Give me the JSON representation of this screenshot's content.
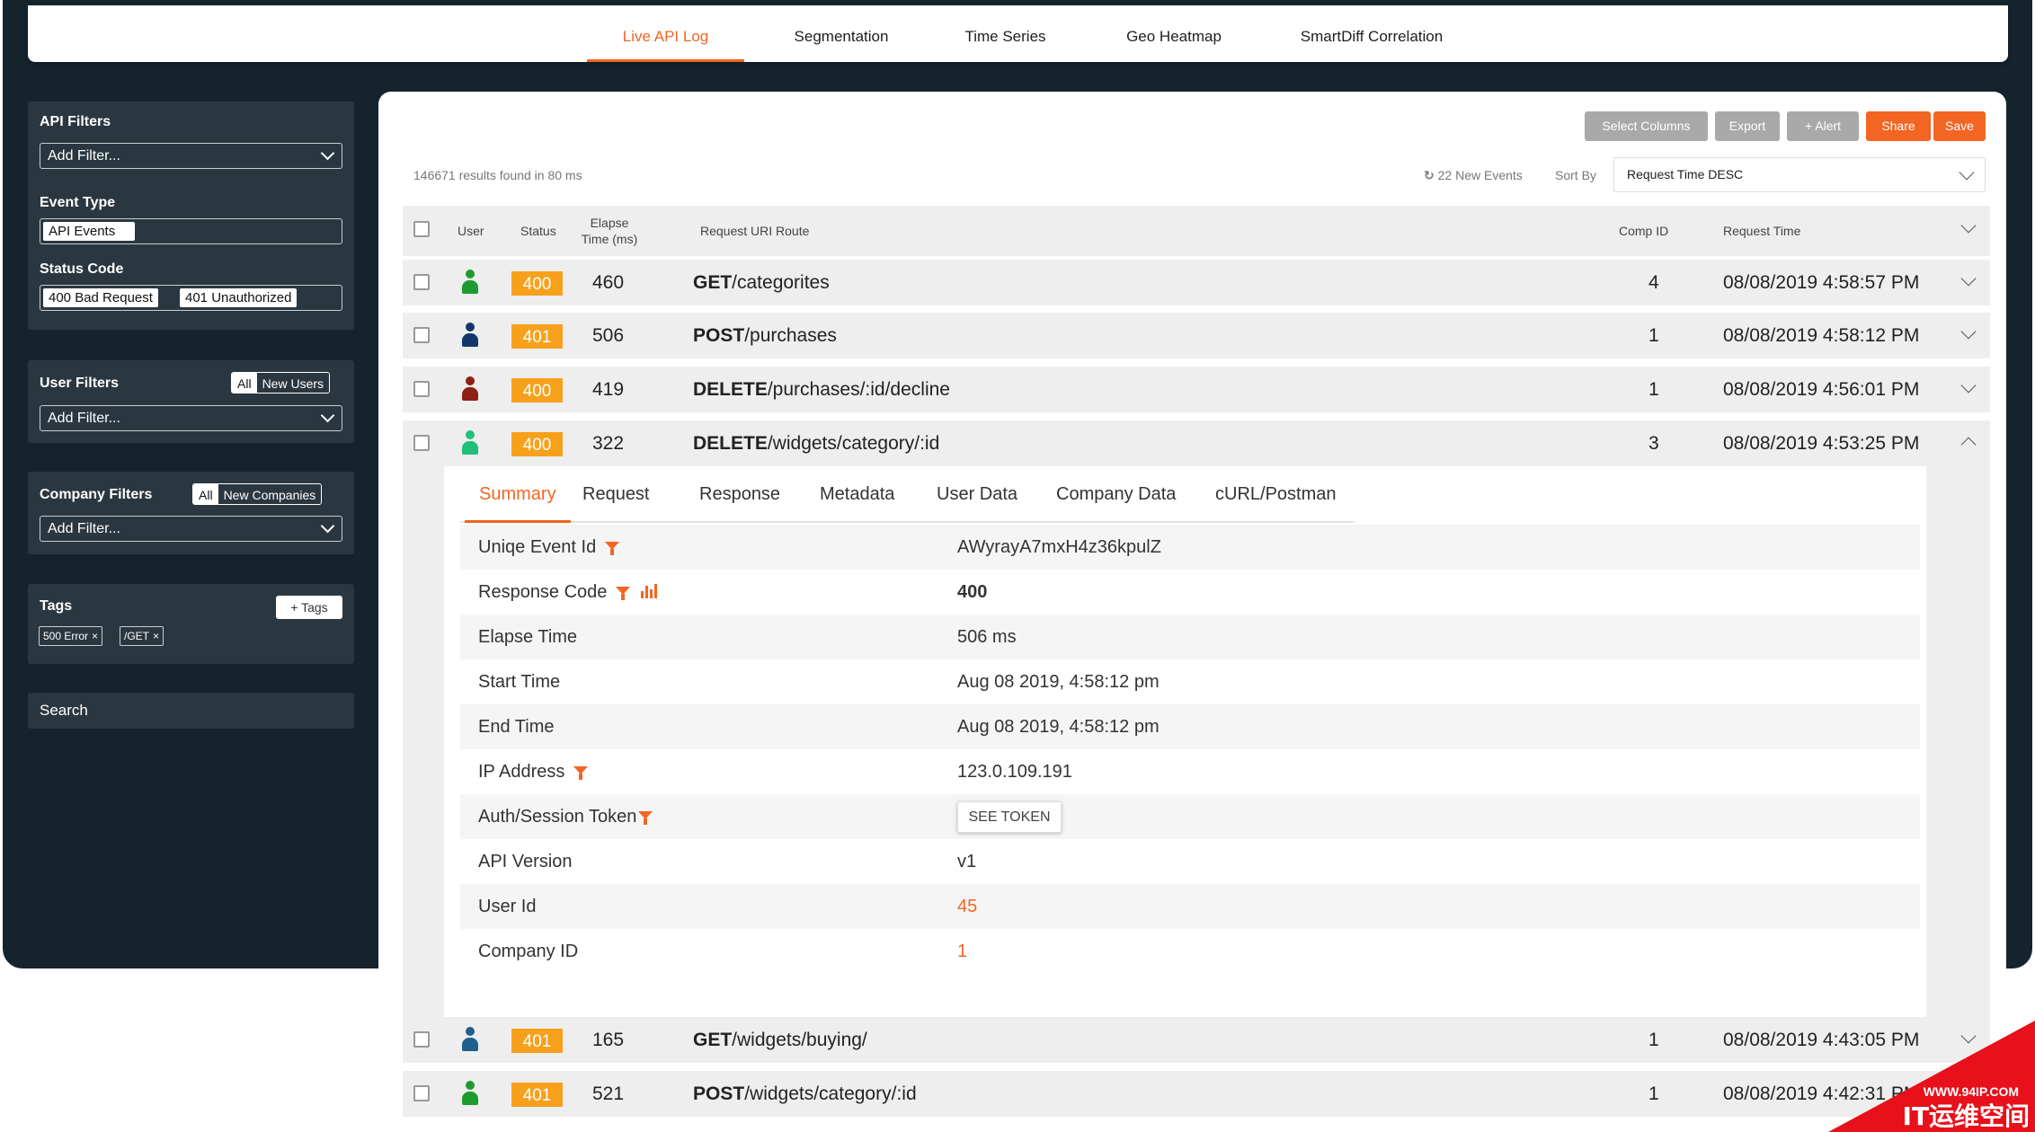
{
  "nav": {
    "tabs": [
      {
        "label": "Live API Log",
        "active": true
      },
      {
        "label": "Segmentation",
        "active": false
      },
      {
        "label": "Time Series",
        "active": false
      },
      {
        "label": "Geo Heatmap",
        "active": false
      },
      {
        "label": "SmartDiff Correlation",
        "active": false
      }
    ]
  },
  "sidebar": {
    "api_filters": {
      "title": "API Filters",
      "placeholder": "Add Filter..."
    },
    "event_type": {
      "title": "Event Type",
      "chips": [
        "API Events"
      ]
    },
    "status_code": {
      "title": "Status Code",
      "chips": [
        "400 Bad Request",
        "401 Unauthorized"
      ]
    },
    "user_filters": {
      "title": "User Filters",
      "toggle": [
        "All",
        "New Users"
      ],
      "placeholder": "Add Filter..."
    },
    "company_filters": {
      "title": "Company Filters",
      "toggle": [
        "All",
        "New Companies"
      ],
      "placeholder": "Add Filter..."
    },
    "tags": {
      "title": "Tags",
      "add_label": "+ Tags",
      "chips": [
        "500 Error",
        "/GET"
      ]
    },
    "search_label": "Search"
  },
  "toolbar": {
    "select_columns": "Select Columns",
    "export": "Export",
    "alert": "+ Alert",
    "share": "Share",
    "save": "Save"
  },
  "results": {
    "summary": "146671 results found in 80 ms",
    "new_events": "22 New Events",
    "sort_by_label": "Sort By",
    "sort_value": "Request Time DESC"
  },
  "table": {
    "headers": {
      "user": "User",
      "status": "Status",
      "elapse_1": "Elapse",
      "elapse_2": "Time (ms)",
      "route": "Request URI Route",
      "comp_id": "Comp ID",
      "request_time": "Request Time"
    },
    "rows": [
      {
        "user_color": "#1e9b2e",
        "status": "400",
        "elapse": "460",
        "method": "GET",
        "path": "/categorites",
        "comp_id": "4",
        "time": "08/08/2019 4:58:57 PM"
      },
      {
        "user_color": "#12386b",
        "status": "401",
        "elapse": "506",
        "method": "POST",
        "path": "/purchases",
        "comp_id": "1",
        "time": "08/08/2019 4:58:12 PM"
      },
      {
        "user_color": "#8b2212",
        "status": "400",
        "elapse": "419",
        "method": "DELETE",
        "path": "/purchases/:id/decline",
        "comp_id": "1",
        "time": "08/08/2019 4:56:01 PM"
      },
      {
        "user_color": "#1fc07a",
        "status": "400",
        "elapse": "322",
        "method": "DELETE",
        "path": "/widgets/category/:id",
        "comp_id": "3",
        "time": "08/08/2019 4:53:25 PM"
      },
      {
        "user_color": "#1f5f8f",
        "status": "401",
        "elapse": "165",
        "method": "GET",
        "path": "/widgets/buying/",
        "comp_id": "1",
        "time": "08/08/2019 4:43:05 PM"
      },
      {
        "user_color": "#1e9b2e",
        "status": "401",
        "elapse": "521",
        "method": "POST",
        "path": "/widgets/category/:id",
        "comp_id": "1",
        "time": "08/08/2019 4:42:31 PM"
      }
    ]
  },
  "detail": {
    "tabs": [
      "Summary",
      "Request",
      "Response",
      "Metadata",
      "User Data",
      "Company Data",
      "cURL/Postman"
    ],
    "fields": [
      {
        "key": "Uniqe Event Id",
        "value": "AWyrayA7mxH4z36kpulZ"
      },
      {
        "key": "Response Code",
        "value": "400"
      },
      {
        "key": "Elapse Time",
        "value": "506 ms"
      },
      {
        "key": "Start Time",
        "value": "Aug 08 2019, 4:58:12 pm"
      },
      {
        "key": "End Time",
        "value": "Aug 08 2019, 4:58:12 pm"
      },
      {
        "key": "IP Address",
        "value": "123.0.109.191"
      },
      {
        "key": "Auth/Session Token",
        "value": "SEE TOKEN"
      },
      {
        "key": "API Version",
        "value": "v1"
      },
      {
        "key": "User Id",
        "value": "45"
      },
      {
        "key": "Company ID",
        "value": "1"
      }
    ]
  },
  "watermark": {
    "url": "WWW.94IP.COM",
    "text": "IT运维空间"
  },
  "colors": {
    "accent": "#f26522",
    "status_badge": "#f7a01c",
    "sidebar_bg": "#15232d",
    "panel_bg": "#2b3740"
  }
}
